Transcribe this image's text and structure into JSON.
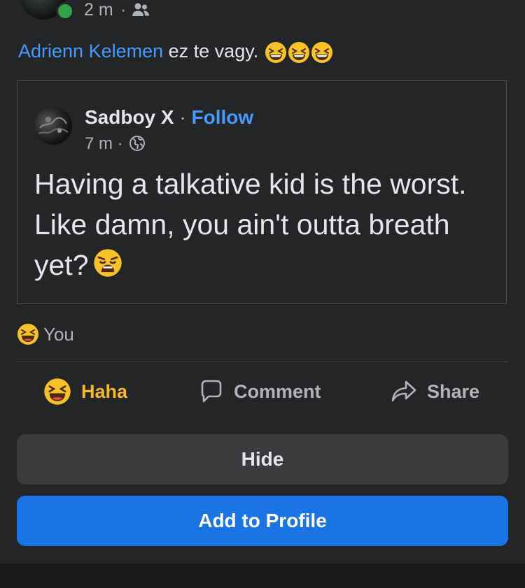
{
  "top_meta": {
    "time": "2 m",
    "separator": "·",
    "audience_icon": "friends-icon"
  },
  "caption": {
    "mention": "Adrienn Kelemen",
    "text": " ez te vagy. ",
    "emojis": [
      "laughing-face-emoji",
      "laughing-face-emoji",
      "laughing-face-emoji"
    ]
  },
  "shared_post": {
    "author": "Sadboy X",
    "separator": " · ",
    "follow_label": "Follow",
    "time": "7 m",
    "time_separator": " · ",
    "audience_icon": "globe-icon",
    "text": "Having a talkative kid is the worst. Like damn, you ain't outta breath yet?",
    "text_emoji": "weary-face-emoji"
  },
  "reactions": {
    "icon": "haha-reaction-emoji",
    "label": "You"
  },
  "actions": {
    "haha_label": "Haha",
    "comment_label": "Comment",
    "share_label": "Share"
  },
  "buttons": {
    "hide_label": "Hide",
    "add_to_profile_label": "Add to Profile"
  },
  "colors": {
    "background": "#242526",
    "link": "#4599ff",
    "haha": "#f7b928",
    "primary_button": "#1b74e4",
    "secondary_button": "#3a3b3c",
    "online": "#31a24c"
  }
}
